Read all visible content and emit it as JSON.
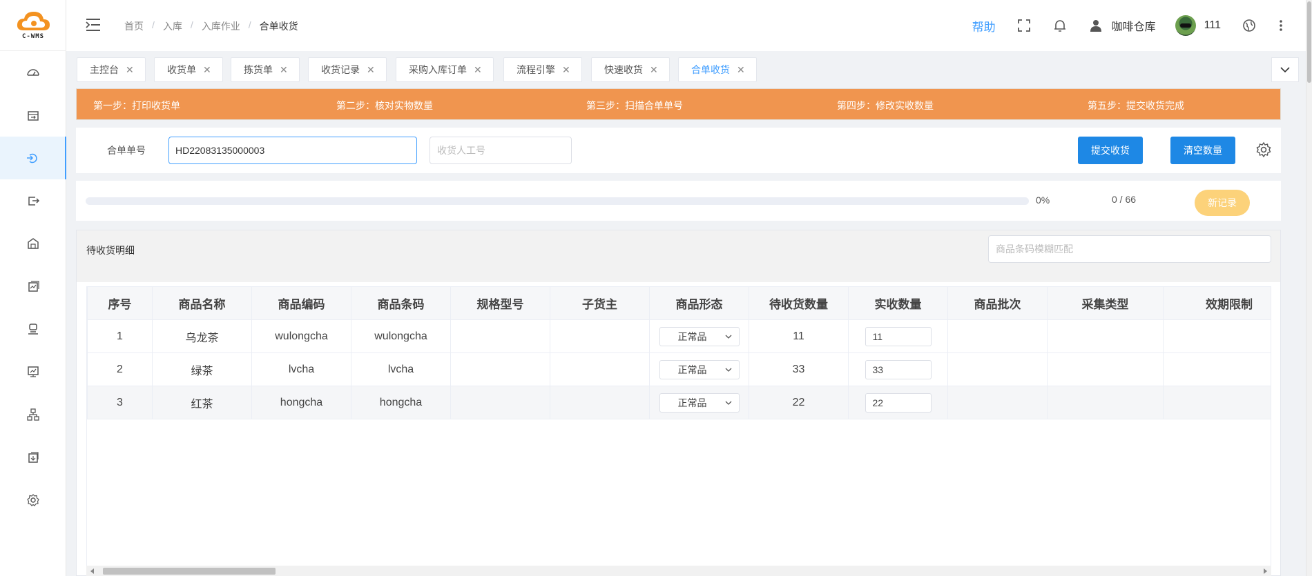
{
  "logo": {
    "text": "C-WMS"
  },
  "sidebar": {
    "items": [
      {
        "name": "dashboard",
        "icon": "dashboard-icon"
      },
      {
        "name": "receipt",
        "icon": "receipt-icon"
      },
      {
        "name": "inbound",
        "icon": "inbound-icon",
        "active": true
      },
      {
        "name": "outbound",
        "icon": "outbound-icon"
      },
      {
        "name": "warehouse",
        "icon": "warehouse-icon"
      },
      {
        "name": "report",
        "icon": "report-icon"
      },
      {
        "name": "staff",
        "icon": "staff-icon"
      },
      {
        "name": "chart",
        "icon": "chart-icon"
      },
      {
        "name": "org",
        "icon": "org-icon"
      },
      {
        "name": "download",
        "icon": "download-icon"
      },
      {
        "name": "settings",
        "icon": "settings-icon"
      }
    ]
  },
  "header": {
    "breadcrumb": [
      "首页",
      "入库",
      "入库作业",
      "合单收货"
    ],
    "help": "帮助",
    "warehouse": "咖啡仓库",
    "user_id": "111"
  },
  "tabs": [
    {
      "label": "主控台"
    },
    {
      "label": "收货单"
    },
    {
      "label": "拣货单"
    },
    {
      "label": "收货记录"
    },
    {
      "label": "采购入库订单"
    },
    {
      "label": "流程引擎"
    },
    {
      "label": "快速收货"
    },
    {
      "label": "合单收货",
      "active": true
    }
  ],
  "steps": [
    "第一步：打印收货单",
    "第二步：核对实物数量",
    "第三步：扫描合单单号",
    "第四步：修改实收数量",
    "第五步：提交收货完成"
  ],
  "form": {
    "order_label": "合单单号",
    "order_value": "HD22083135000003",
    "worker_placeholder": "收货人工号",
    "submit_label": "提交收货",
    "clear_label": "清空数量"
  },
  "progress": {
    "percent": 0,
    "percent_text": "0%",
    "count_text": "0 / 66",
    "new_record_label": "新记录"
  },
  "detail": {
    "title": "待收货明细",
    "search_placeholder": "商品条码模糊匹配",
    "columns": [
      "序号",
      "商品名称",
      "商品编码",
      "商品条码",
      "规格型号",
      "子货主",
      "商品形态",
      "待收货数量",
      "实收数量",
      "商品批次",
      "采集类型",
      "效期限制"
    ],
    "rows": [
      {
        "no": "1",
        "name": "乌龙茶",
        "code": "wulongcha",
        "barcode": "wulongcha",
        "spec": "",
        "owner": "",
        "form": "正常品",
        "pending": "11",
        "actual": "11",
        "batch": "",
        "collect": "",
        "expiry": ""
      },
      {
        "no": "2",
        "name": "绿茶",
        "code": "lvcha",
        "barcode": "lvcha",
        "spec": "",
        "owner": "",
        "form": "正常品",
        "pending": "33",
        "actual": "33",
        "batch": "",
        "collect": "",
        "expiry": ""
      },
      {
        "no": "3",
        "name": "红茶",
        "code": "hongcha",
        "barcode": "hongcha",
        "spec": "",
        "owner": "",
        "form": "正常品",
        "pending": "22",
        "actual": "22",
        "batch": "",
        "collect": "",
        "expiry": ""
      }
    ]
  },
  "colors": {
    "primary": "#409eff",
    "button_blue": "#1e88e5",
    "steps_bg": "#f0954f",
    "new_record_bg": "#fcd27a"
  }
}
